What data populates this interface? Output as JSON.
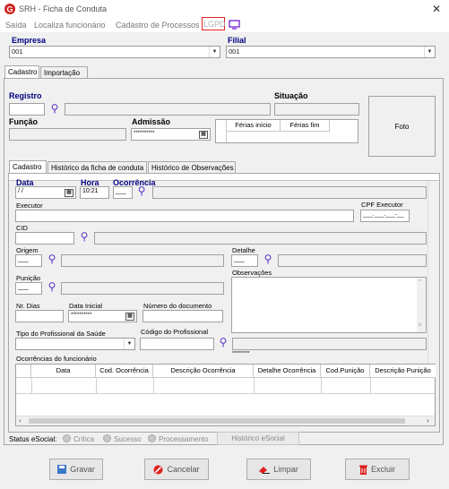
{
  "window": {
    "title": "SRH - Ficha de Conduta",
    "close": "✕"
  },
  "menu": [
    "Saída",
    "Localiza funcionário",
    "Cadastro de Processos",
    "LGPD"
  ],
  "empresa": {
    "label": "Empresa",
    "value": "001"
  },
  "filial": {
    "label": "Filial",
    "value": "001"
  },
  "top_tabs": [
    "Cadastro",
    "Importação"
  ],
  "registro": {
    "label": "Registro"
  },
  "situacao": {
    "label": "Situação"
  },
  "funcao": {
    "label": "Função"
  },
  "admissao": {
    "label": "Admissão",
    "value": "**********"
  },
  "ferias": {
    "inicio": "Férias início",
    "fim": "Férias fim"
  },
  "foto": "Foto",
  "inner_tabs": [
    "Cadastro",
    "Histórico da ficha de conduta",
    "Histórico de Observações"
  ],
  "form": {
    "data_label": "Data",
    "data_value": " / /",
    "hora_label": "Hora",
    "hora_value": "10:21",
    "ocorrencia_label": "Ocorrência",
    "ocorrencia_value": "___",
    "executor_label": "Executor",
    "cpf_label": "CPF Executor",
    "cpf_value": "___.___.___-__",
    "cid_label": "CID",
    "origem_label": "Origem",
    "origem_value": "___",
    "detalhe_label": "Detalhe",
    "detalhe_value": "___",
    "punicao_label": "Punição",
    "punicao_value": "___",
    "observacoes_label": "Observações",
    "nrdias_label": "Nr. Dias",
    "datainicial_label": "Data Inicial",
    "datainicial_value": "**********",
    "numdoc_label": "Número do documento",
    "tipoprof_label": "Tipo do Profissional da Saúde",
    "codprof_label": "Código do Profissional",
    "mask_small": "**********",
    "ocorrencias_label": "Ocorrências do funcionário"
  },
  "grid_columns": [
    "Data",
    "Cod. Ocorrência",
    "Descrição Ocorrência",
    "Detalhe Ocorrência",
    "Cod.Punição",
    "Descrição Punição"
  ],
  "status": {
    "label": "Status eSocial:",
    "options": [
      "Crítica",
      "Sucesso",
      "Processamento"
    ],
    "historico": "Histórico eSocial"
  },
  "buttons": {
    "gravar": "Gravar",
    "cancelar": "Cancelar",
    "limpar": "Limpar",
    "excluir": "Excluir"
  },
  "colors": {
    "accent": "#000080",
    "lgpd_border": "#e02020",
    "icon": "#5a34c0"
  }
}
